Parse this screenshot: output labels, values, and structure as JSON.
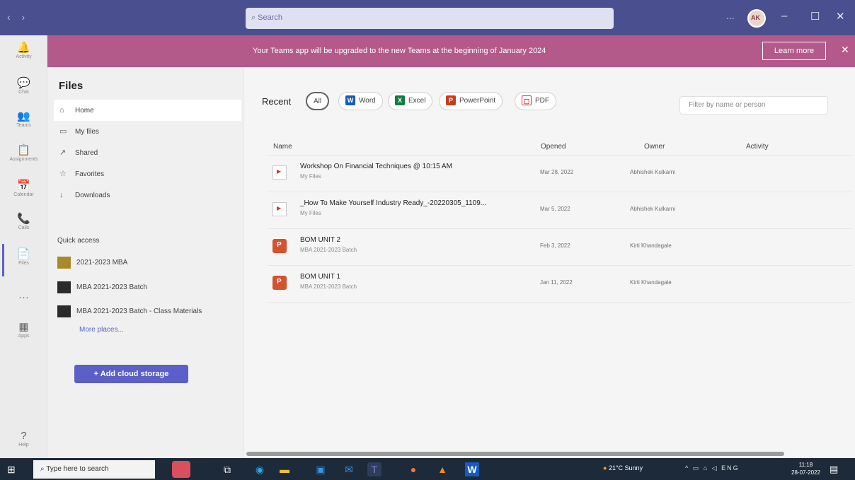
{
  "window": {
    "nav_arrows": "‹ ›",
    "search_placeholder": "Search",
    "search_icon": "search-icon",
    "more_label": "...",
    "avatar_initials": "AK",
    "minimize": "–",
    "maximize": "☐",
    "close": "✕"
  },
  "banner": {
    "message": "Your Teams app will be upgraded to the new Teams at the beginning of January 2024",
    "learn_more": "Learn more",
    "dismiss": "✕"
  },
  "rail": [
    {
      "label": "Activity",
      "icon": "bell-icon",
      "glyph": "🔔"
    },
    {
      "label": "Chat",
      "icon": "chat-icon",
      "glyph": "💬"
    },
    {
      "label": "Teams",
      "icon": "teams-icon",
      "glyph": "👥"
    },
    {
      "label": "Assignments",
      "icon": "assignments-icon",
      "glyph": "📋"
    },
    {
      "label": "Calendar",
      "icon": "calendar-icon",
      "glyph": "📅"
    },
    {
      "label": "Calls",
      "icon": "phone-icon",
      "glyph": "📞"
    },
    {
      "label": "Files",
      "icon": "file-icon",
      "glyph": "📄"
    },
    {
      "label": "...",
      "icon": "more-icon",
      "glyph": "···"
    },
    {
      "label": "Apps",
      "icon": "apps-icon",
      "glyph": "▦"
    },
    {
      "label": "Help",
      "icon": "help-icon",
      "glyph": "?"
    }
  ],
  "files_panel": {
    "title": "Files",
    "nav": [
      {
        "label": "Home",
        "icon": "home-icon",
        "glyph": "⌂",
        "active": true
      },
      {
        "label": "My files",
        "icon": "folder-icon",
        "glyph": "▭",
        "active": false
      },
      {
        "label": "Shared",
        "icon": "share-icon",
        "glyph": "↗",
        "active": false
      },
      {
        "label": "Favorites",
        "icon": "star-icon",
        "glyph": "☆",
        "active": false
      },
      {
        "label": "Downloads",
        "icon": "download-icon",
        "glyph": "↓",
        "active": false
      }
    ],
    "quick_access_title": "Quick access",
    "quick_access": [
      {
        "label": "2021-2023 MBA",
        "color": "#a88a2a"
      },
      {
        "label": "MBA 2021-2023 Batch",
        "color": "#2b2b2b"
      },
      {
        "label": "MBA 2021-2023 Batch - Class Materials",
        "color": "#2b2b2b"
      }
    ],
    "more_places": "More places...",
    "add_cloud": "+ Add cloud storage"
  },
  "main": {
    "recent_label": "Recent",
    "chips": [
      {
        "label": "All",
        "active": true,
        "icon": "",
        "color": ""
      },
      {
        "label": "Word",
        "active": false,
        "icon": "W",
        "color": "#185abd"
      },
      {
        "label": "Excel",
        "active": false,
        "icon": "X",
        "color": "#107c41"
      },
      {
        "label": "PowerPoint",
        "active": false,
        "icon": "P",
        "color": "#c43e1c"
      },
      {
        "label": "PDF",
        "active": false,
        "icon": "▢",
        "color": "#d13438"
      }
    ],
    "filter_placeholder": "Filter by name or person",
    "columns": {
      "name": "Name",
      "opened": "Opened",
      "owner": "Owner",
      "activity": "Activity"
    },
    "rows": [
      {
        "name": "Workshop On Financial Techniques @ 10:15 AM",
        "location": "My Files",
        "opened": "Mar 28, 2022",
        "owner": "Abhishek Kulkarni",
        "type": "video"
      },
      {
        "name": "_How To Make Yourself Industry Ready_-20220305_1109...",
        "location": "My Files",
        "opened": "Mar 5, 2022",
        "owner": "Abhishek Kulkarni",
        "type": "video"
      },
      {
        "name": "BOM UNIT 2",
        "location": "MBA 2021-2023 Batch",
        "opened": "Feb 3, 2022",
        "owner": "Kirti Khandagale",
        "type": "ppt"
      },
      {
        "name": "BOM UNIT 1",
        "location": "MBA 2021-2023 Batch",
        "opened": "Jan 11, 2022",
        "owner": "Kirti Khandagale",
        "type": "ppt"
      }
    ]
  },
  "taskbar": {
    "start": "⊞",
    "search_placeholder": "Type here to search",
    "apps": [
      {
        "icon": "task-view-icon",
        "glyph": "⧉",
        "color": "#ffffff"
      },
      {
        "icon": "edge-icon",
        "glyph": "◉",
        "color": "#2fa4e7"
      },
      {
        "icon": "file-explorer-icon",
        "glyph": "▬",
        "color": "#f2c12e"
      },
      {
        "icon": "store-icon",
        "glyph": "▣",
        "color": "#3a96dd"
      },
      {
        "icon": "mail-icon",
        "glyph": "✉",
        "color": "#3a96dd"
      },
      {
        "icon": "teams-app-icon",
        "glyph": "T",
        "color": "#7b83eb"
      },
      {
        "icon": "firefox-icon",
        "glyph": "●",
        "color": "#ff7139"
      },
      {
        "icon": "vlc-icon",
        "glyph": "▲",
        "color": "#f08a24"
      },
      {
        "icon": "word-app-icon",
        "glyph": "W",
        "color": "#185abd"
      }
    ],
    "weather": "21°C Sunny",
    "tray": "^ ▭ ⌂ ◁ ENG",
    "time": "11:18",
    "date": "28-07-2022",
    "notification": "▤"
  }
}
